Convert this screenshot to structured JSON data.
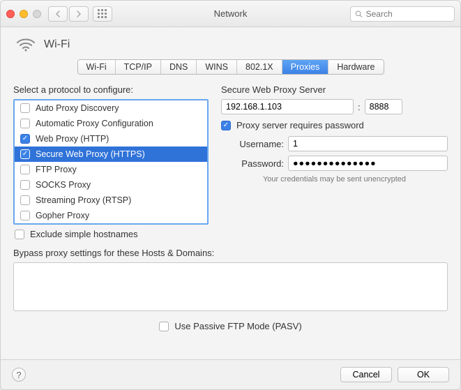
{
  "window": {
    "title": "Network",
    "search_placeholder": "Search"
  },
  "header": {
    "interface": "Wi-Fi"
  },
  "tabs": [
    "Wi-Fi",
    "TCP/IP",
    "DNS",
    "WINS",
    "802.1X",
    "Proxies",
    "Hardware"
  ],
  "active_tab": "Proxies",
  "left": {
    "label": "Select a protocol to configure:",
    "protocols": [
      {
        "label": "Auto Proxy Discovery",
        "checked": false,
        "selected": false
      },
      {
        "label": "Automatic Proxy Configuration",
        "checked": false,
        "selected": false
      },
      {
        "label": "Web Proxy (HTTP)",
        "checked": true,
        "selected": false
      },
      {
        "label": "Secure Web Proxy (HTTPS)",
        "checked": true,
        "selected": true
      },
      {
        "label": "FTP Proxy",
        "checked": false,
        "selected": false
      },
      {
        "label": "SOCKS Proxy",
        "checked": false,
        "selected": false
      },
      {
        "label": "Streaming Proxy (RTSP)",
        "checked": false,
        "selected": false
      },
      {
        "label": "Gopher Proxy",
        "checked": false,
        "selected": false
      }
    ],
    "exclude_simple": {
      "label": "Exclude simple hostnames",
      "checked": false
    }
  },
  "right": {
    "server_label": "Secure Web Proxy Server",
    "host": "192.168.1.103",
    "port": "8888",
    "requires_password": {
      "label": "Proxy server requires password",
      "checked": true
    },
    "username_label": "Username:",
    "username": "1",
    "password_label": "Password:",
    "password": "●●●●●●●●●●●●●●",
    "hint": "Your credentials may be sent unencrypted"
  },
  "bypass": {
    "label": "Bypass proxy settings for these Hosts & Domains:",
    "value": ""
  },
  "pasv": {
    "label": "Use Passive FTP Mode (PASV)",
    "checked": false
  },
  "footer": {
    "cancel": "Cancel",
    "ok": "OK"
  }
}
